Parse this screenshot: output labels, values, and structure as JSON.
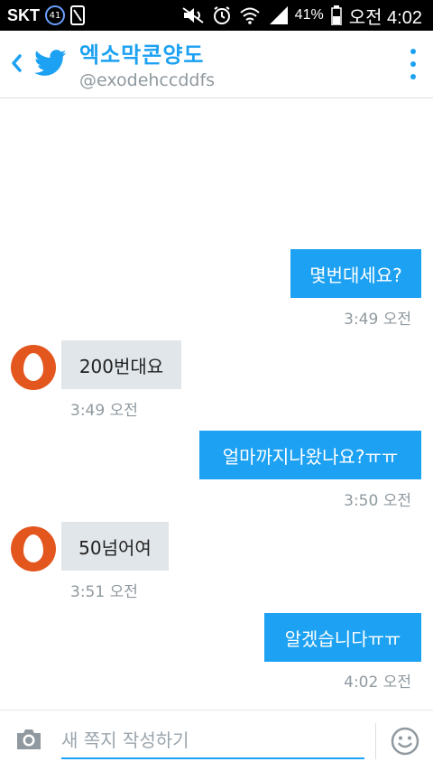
{
  "status_bar": {
    "carrier": "SKT",
    "badge": "41",
    "battery": "41%",
    "time": "오전 4:02"
  },
  "header": {
    "title": "엑소막콘양도",
    "handle": "@exodehccddfs",
    "back_icon": "chevron-left-icon",
    "logo_icon": "twitter-bird-icon",
    "more_icon": "more-vertical-icon"
  },
  "messages": [
    {
      "direction": "out",
      "text": "몇번대세요?",
      "time": "3:49 오전"
    },
    {
      "direction": "in",
      "text": "200번대요",
      "time": "3:49 오전"
    },
    {
      "direction": "out",
      "text": "얼마까지나왔나요?ㅠㅠ",
      "time": "3:50 오전"
    },
    {
      "direction": "in",
      "text": "50넘어여",
      "time": "3:51 오전"
    },
    {
      "direction": "out",
      "text": "알겠습니다ㅠㅠ",
      "time": "4:02 오전"
    }
  ],
  "composer": {
    "placeholder": "새 쪽지 작성하기",
    "camera_icon": "camera-icon",
    "emoji_icon": "smiley-icon"
  },
  "colors": {
    "accent": "#1da1f2",
    "incoming_bubble": "#e1e6ea",
    "avatar": "#e3561e"
  }
}
